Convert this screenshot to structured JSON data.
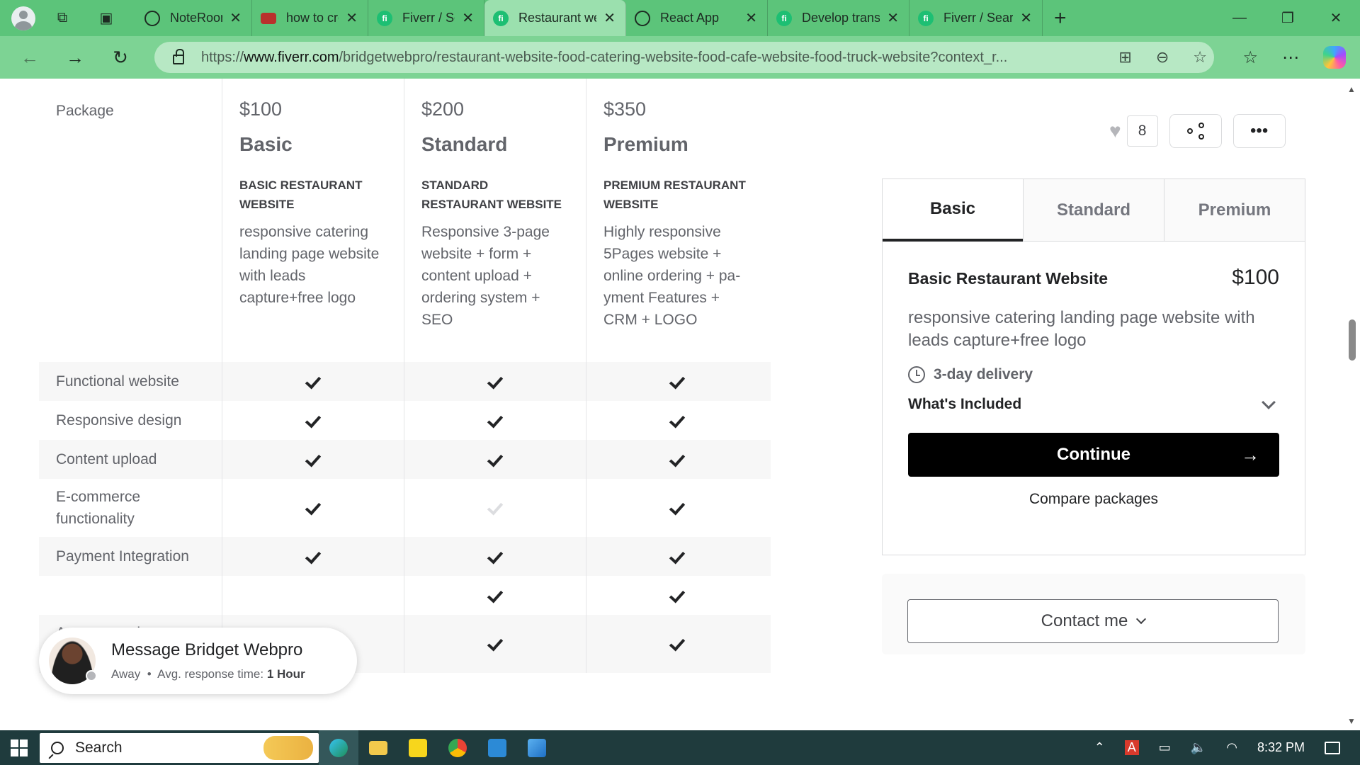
{
  "browser": {
    "tabs": [
      {
        "title": "NoteRoom",
        "icon": "globe-icon",
        "active": false
      },
      {
        "title": "how to create",
        "icon": "youtube-icon",
        "active": false
      },
      {
        "title": "Fiverr / Search",
        "icon": "fiverr-icon",
        "active": false
      },
      {
        "title": "Restaurant we",
        "icon": "fiverr-icon",
        "active": true
      },
      {
        "title": "React App",
        "icon": "globe-icon",
        "active": false
      },
      {
        "title": "Develop trans",
        "icon": "fiverr-icon",
        "active": false
      },
      {
        "title": "Fiverr / Search",
        "icon": "fiverr-icon",
        "active": false
      }
    ],
    "url_prefix": "https://",
    "url_host": "www.fiverr.com",
    "url_path": "/bridgetwebpro/restaurant-website-food-catering-website-food-cafe-website-food-truck-website?context_r..."
  },
  "comparison": {
    "label_package": "Package",
    "packages": [
      {
        "price": "$100",
        "name": "Basic",
        "title": "BASIC RESTAURANT WEBSITE",
        "desc": "responsive catering landing page website with leads capture+free logo"
      },
      {
        "price": "$200",
        "name": "Standard",
        "title": "STANDARD RESTAURANT WEBSITE",
        "desc": "Responsive 3-page website + form + content upload + ordering system + SEO"
      },
      {
        "price": "$350",
        "name": "Premium",
        "title": "PREMIUM RESTAURANT WEBSITE",
        "desc": "Highly responsive 5Pages website + online ordering + pa-yment Features + CRM + LOGO"
      }
    ],
    "features": [
      {
        "name": "Functional website",
        "checks": [
          true,
          true,
          true
        ]
      },
      {
        "name": "Responsive design",
        "checks": [
          true,
          true,
          true
        ]
      },
      {
        "name": "Content upload",
        "checks": [
          true,
          true,
          true
        ]
      },
      {
        "name": "E-commerce functionality",
        "checks": [
          true,
          false,
          true
        ]
      },
      {
        "name": "Payment Integration",
        "checks": [
          true,
          true,
          true
        ]
      },
      {
        "name": "",
        "checks": [
          false,
          true,
          true
        ]
      },
      {
        "name": "Autoresponder integration",
        "checks": [
          true,
          true,
          true
        ]
      }
    ]
  },
  "actions": {
    "like_count": "8"
  },
  "card": {
    "tabs": [
      "Basic",
      "Standard",
      "Premium"
    ],
    "active_tab": 0,
    "package_name": "Basic Restaurant Website",
    "price": "$100",
    "desc": "responsive catering landing page website with leads capture+free logo",
    "delivery": "3-day delivery",
    "included_label": "What's Included",
    "continue_label": "Continue",
    "compare_label": "Compare packages",
    "contact_label": "Contact me"
  },
  "message": {
    "title": "Message Bridget Webpro",
    "status": "Away",
    "response_label": "Avg. response time:",
    "response_value": "1 Hour"
  },
  "taskbar": {
    "search_placeholder": "Search",
    "time": "8:32 PM"
  },
  "colors": {
    "fiverr_green": "#1dbf73",
    "browser_frame": "#5cc47a"
  }
}
